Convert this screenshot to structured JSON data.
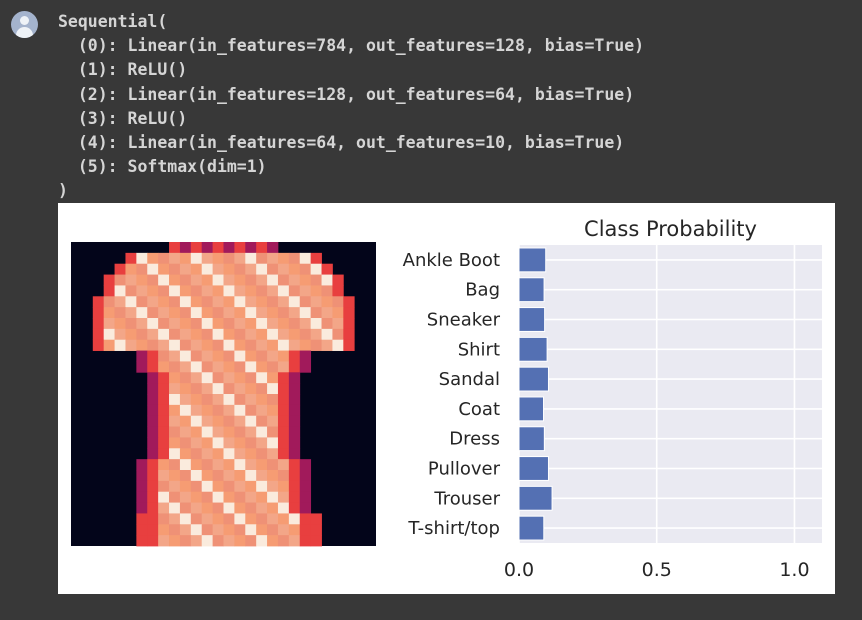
{
  "code_output": {
    "lines": [
      "Sequential(",
      "  (0): Linear(in_features=784, out_features=128, bias=True)",
      "  (1): ReLU()",
      "  (2): Linear(in_features=128, out_features=64, bias=True)",
      "  (3): ReLU()",
      "  (4): Linear(in_features=64, out_features=10, bias=True)",
      "  (5): Softmax(dim=1)",
      ")"
    ]
  },
  "image_panel": {
    "colormap": [
      "#03051a",
      "#4c1d4b",
      "#a11a5b",
      "#e83f3f",
      "#f69c73",
      "#faebdd"
    ],
    "background": "#03051a"
  },
  "chart_data": {
    "type": "bar",
    "orientation": "horizontal",
    "title": "Class Probability",
    "categories": [
      "T-shirt/top",
      "Trouser",
      "Pullover",
      "Dress",
      "Coat",
      "Sandal",
      "Shirt",
      "Sneaker",
      "Bag",
      "Ankle Boot"
    ],
    "values": [
      0.09,
      0.12,
      0.107,
      0.092,
      0.089,
      0.107,
      0.102,
      0.093,
      0.091,
      0.097
    ],
    "xlim": [
      0,
      1.1
    ],
    "xticks": [
      0.0,
      0.5,
      1.0
    ],
    "xtick_labels": [
      "0.0",
      "0.5",
      "1.0"
    ],
    "grid": true,
    "bar_color": "#5470b3",
    "plot_bg": "#eaeaf2",
    "grid_color": "#ffffff"
  }
}
